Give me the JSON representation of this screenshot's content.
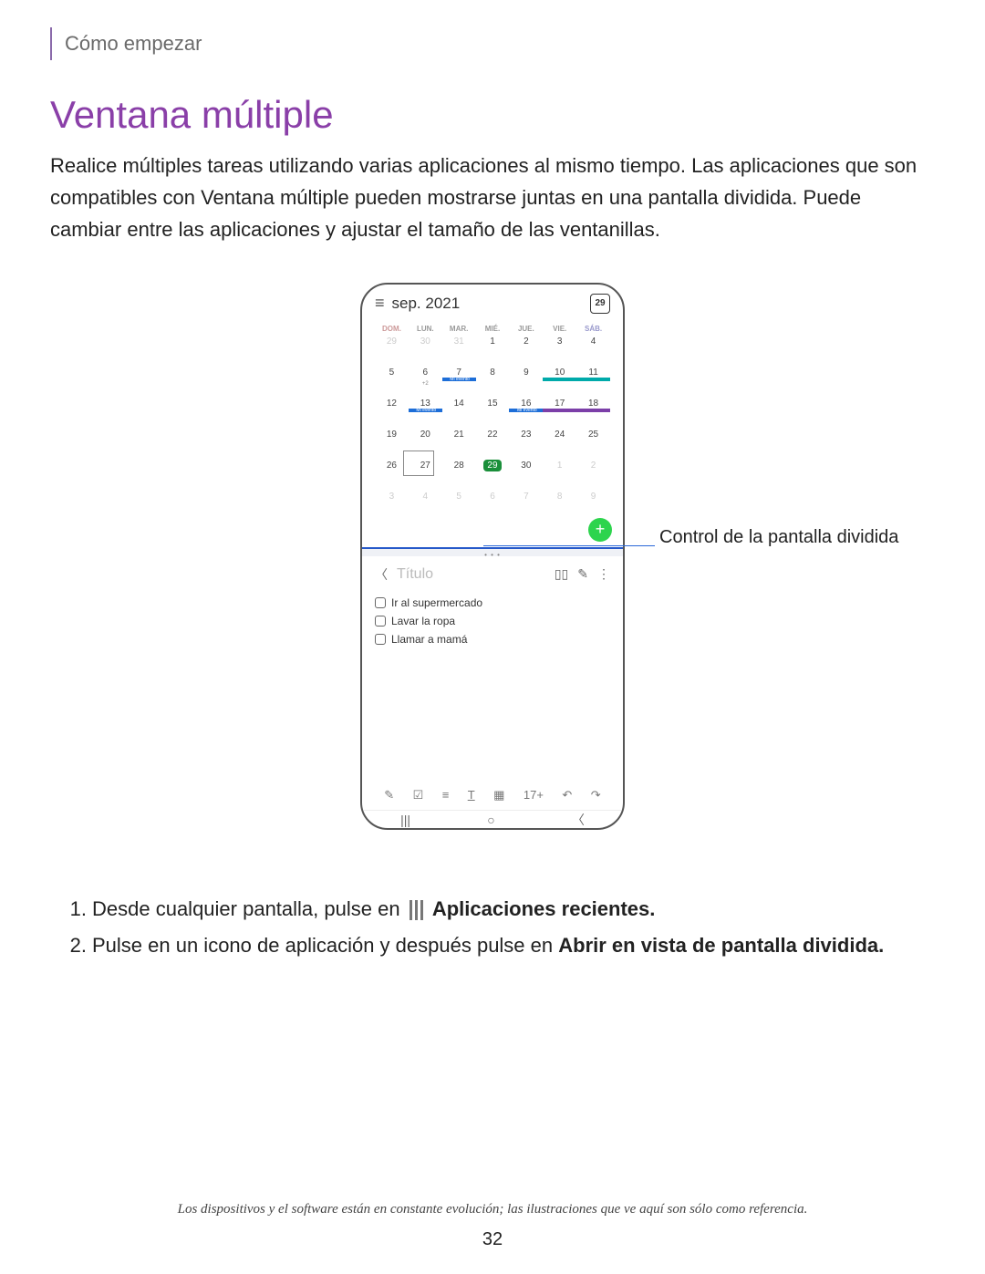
{
  "breadcrumb": "Cómo empezar",
  "title": "Ventana múltiple",
  "intro": "Realice múltiples tareas utilizando varias aplicaciones al mismo tiempo. Las aplicaciones que son compatibles con Ventana múltiple pueden mostrarse juntas en una pantalla dividida. Puede cambiar entre las aplicaciones y ajustar el tamaño de las ventanillas.",
  "phone": {
    "calendar": {
      "month_label": "sep. 2021",
      "today_icon_value": "29",
      "days": [
        "DOM.",
        "LUN.",
        "MAR.",
        "MIÉ.",
        "JUE.",
        "VIE.",
        "SÁB."
      ],
      "weeks": [
        [
          "29",
          "30",
          "31",
          "1",
          "2",
          "3",
          "4"
        ],
        [
          "5",
          "6",
          "7",
          "8",
          "9",
          "10",
          "11"
        ],
        [
          "12",
          "13",
          "14",
          "15",
          "16",
          "17",
          "18"
        ],
        [
          "19",
          "20",
          "21",
          "22",
          "23",
          "24",
          "25"
        ],
        [
          "26",
          "27",
          "28",
          "29",
          "30",
          "1",
          "2"
        ],
        [
          "3",
          "4",
          "5",
          "6",
          "7",
          "8",
          "9"
        ]
      ],
      "event_label": "Mi evento",
      "badge_6": "+2"
    },
    "notes": {
      "title_placeholder": "Título",
      "items": [
        "Ir al supermercado",
        "Lavar la ropa",
        "Llamar a mamá"
      ],
      "plus_label": "17+"
    }
  },
  "callout": "Control de la pantalla dividida",
  "steps": {
    "step1_a": "Desde cualquier pantalla, pulse en",
    "step1_b": "Aplicaciones recientes",
    "step2_a": "Pulse en un icono de aplicación y después pulse en ",
    "step2_b": "Abrir en vista de pantalla dividida"
  },
  "footer": "Los dispositivos y el software están en constante evolución; las ilustraciones que ve aquí son sólo como referencia.",
  "page_number": "32"
}
